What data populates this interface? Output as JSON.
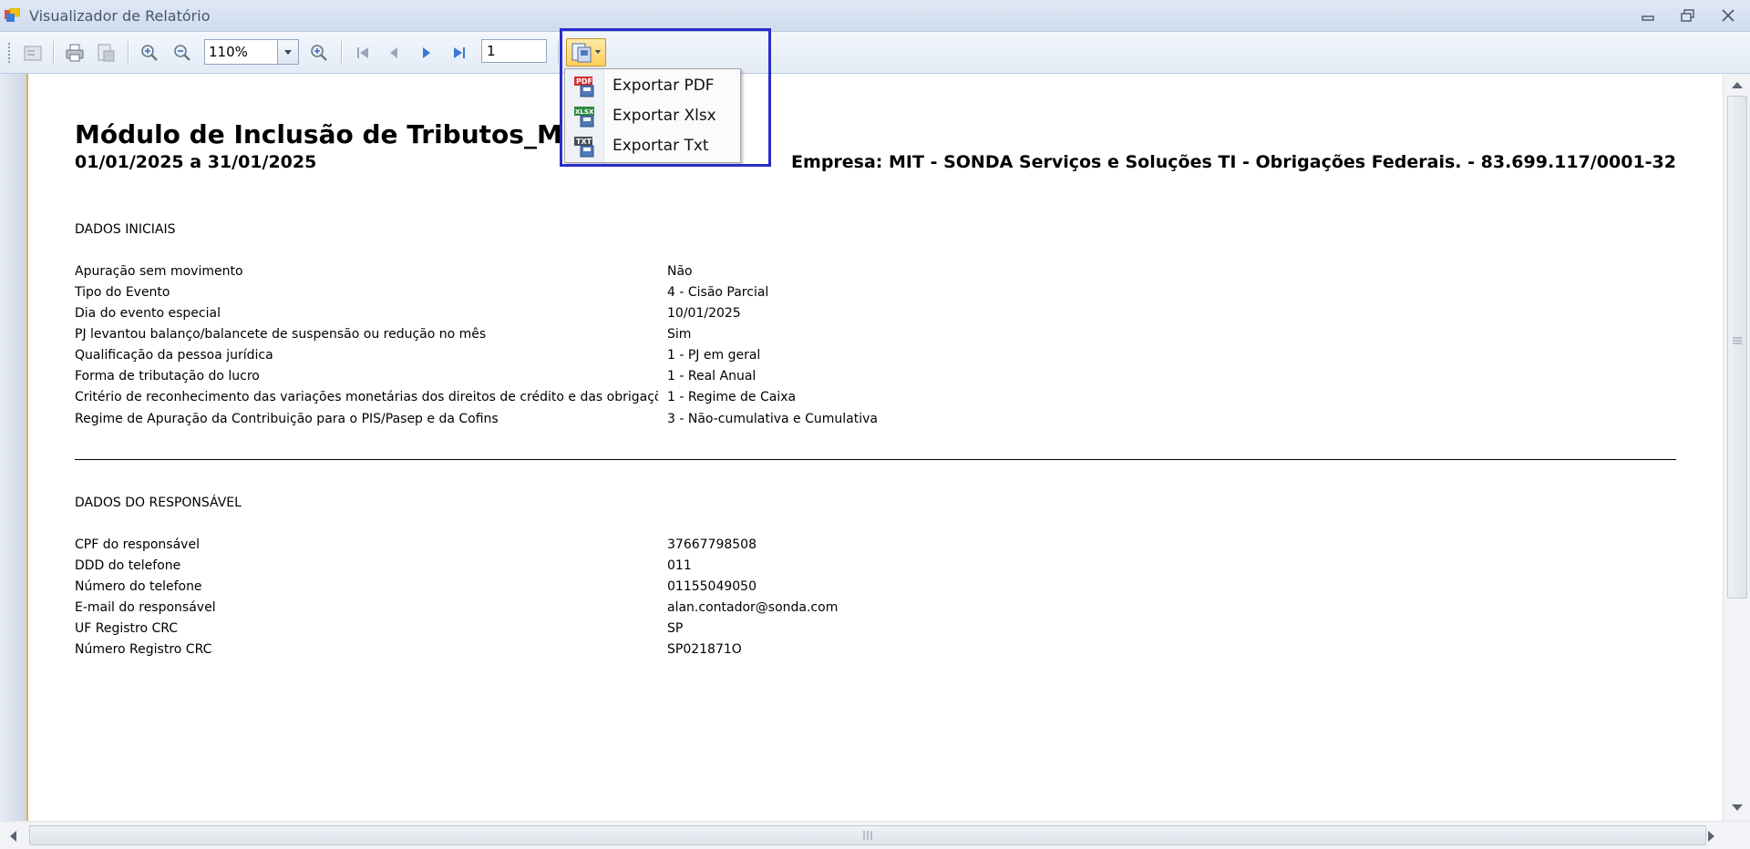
{
  "window": {
    "title": "Visualizador de Relatório"
  },
  "toolbar": {
    "zoom_value": "110%",
    "page_value": "1"
  },
  "export_menu": {
    "items": [
      {
        "label": "Exportar PDF",
        "icon": "pdf-file-icon"
      },
      {
        "label": "Exportar Xlsx",
        "icon": "xlsx-file-icon"
      },
      {
        "label": "Exportar Txt",
        "icon": "txt-file-icon"
      }
    ]
  },
  "report": {
    "title": "Módulo de Inclusão de Tributos_MIT_01_20",
    "period": "01/01/2025 a 31/01/2025",
    "company": "Empresa: MIT - SONDA Serviços e Soluções TI - Obrigações Federais. - 83.699.117/0001-32",
    "dados_iniciais": {
      "title": "DADOS INICIAIS",
      "rows": [
        {
          "label": "Apuração sem movimento",
          "value": "Não"
        },
        {
          "label": "Tipo do Evento",
          "value": "4 - Cisão Parcial"
        },
        {
          "label": "Dia do evento especial",
          "value": "10/01/2025"
        },
        {
          "label": "PJ levantou balanço/balancete de suspensão ou redução no mês",
          "value": "Sim"
        },
        {
          "label": "Qualificação da pessoa jurídica",
          "value": "1 - PJ em geral"
        },
        {
          "label": "Forma de tributação do lucro",
          "value": "1 - Real Anual"
        },
        {
          "label": "Critério de reconhecimento das variações monetárias dos direitos de crédito e das obrigaçõe",
          "value": "1 - Regime de Caixa"
        },
        {
          "label": "Regime de Apuração da Contribuição para o PIS/Pasep e da Cofins",
          "value": "3 - Não-cumulativa e Cumulativa"
        }
      ]
    },
    "dados_responsavel": {
      "title": "DADOS DO RESPONSÁVEL",
      "rows": [
        {
          "label": "CPF do responsável",
          "value": "37667798508"
        },
        {
          "label": "DDD do telefone",
          "value": "011"
        },
        {
          "label": "Número do telefone",
          "value": "01155049050"
        },
        {
          "label": "E-mail do responsável",
          "value": "alan.contador@sonda.com"
        },
        {
          "label": "UF Registro CRC",
          "value": "SP"
        },
        {
          "label": "Número Registro CRC",
          "value": "SP021871O"
        }
      ]
    }
  }
}
